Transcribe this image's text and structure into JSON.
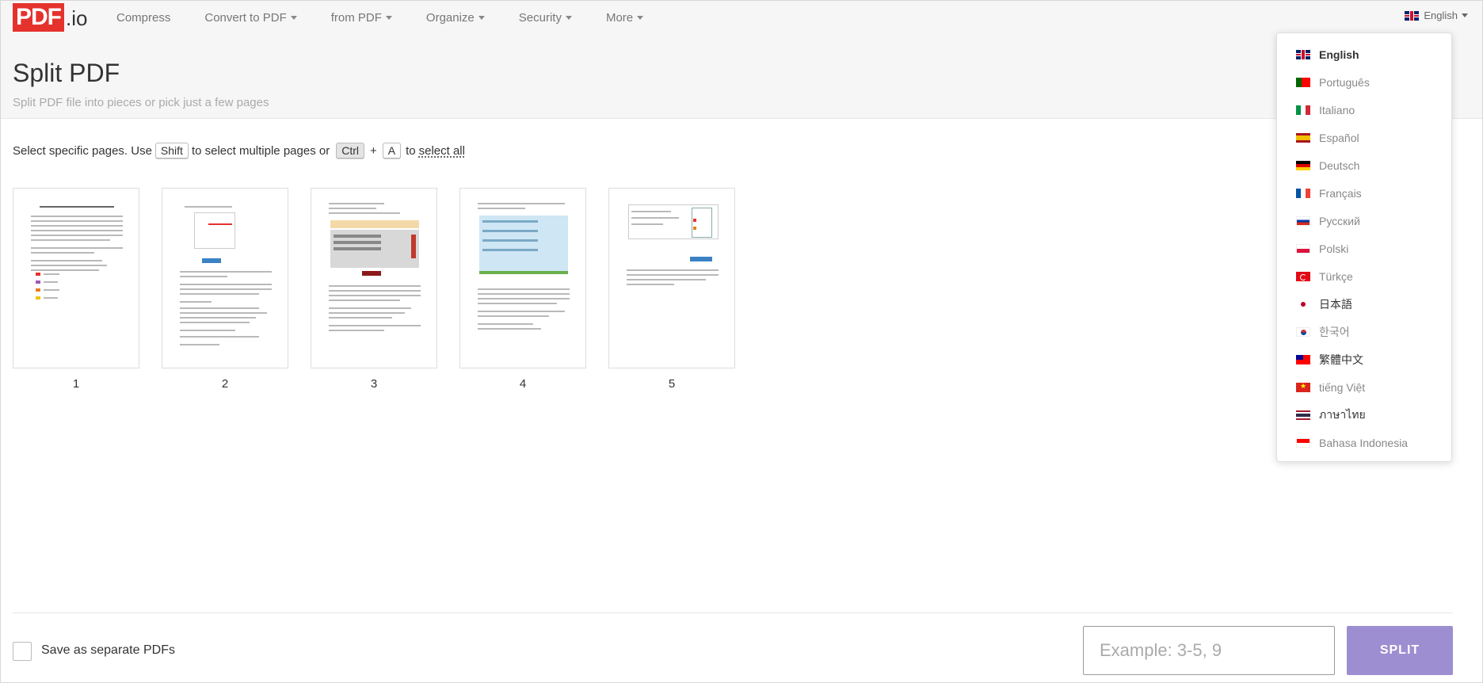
{
  "logo": {
    "brand": "PDF",
    "suffix": ".io"
  },
  "nav": {
    "items": [
      {
        "label": "Compress",
        "dropdown": false
      },
      {
        "label": "Convert to PDF",
        "dropdown": true
      },
      {
        "label": "from PDF",
        "dropdown": true
      },
      {
        "label": "Organize",
        "dropdown": true
      },
      {
        "label": "Security",
        "dropdown": true
      },
      {
        "label": "More",
        "dropdown": true
      }
    ],
    "language": "English"
  },
  "header": {
    "title": "Split PDF",
    "subtitle": "Split PDF file into pieces or pick just a few pages"
  },
  "instructions": {
    "prefix": "Select specific pages. Use",
    "key_shift": "Shift",
    "middle": "to select multiple pages or",
    "key_ctrl": "Ctrl",
    "plus": "+",
    "key_a": "A",
    "to": "to",
    "select_all": "select all"
  },
  "pages": [
    "1",
    "2",
    "3",
    "4",
    "5"
  ],
  "language_menu": [
    {
      "label": "English",
      "flag": "uk",
      "active": true
    },
    {
      "label": "Português",
      "flag": "pt",
      "active": false
    },
    {
      "label": "Italiano",
      "flag": "it",
      "active": false
    },
    {
      "label": "Español",
      "flag": "es",
      "active": false
    },
    {
      "label": "Deutsch",
      "flag": "de",
      "active": false
    },
    {
      "label": "Français",
      "flag": "fr",
      "active": false
    },
    {
      "label": "Русский",
      "flag": "ru",
      "active": false
    },
    {
      "label": "Polski",
      "flag": "pl",
      "active": false
    },
    {
      "label": "Türkçe",
      "flag": "tr",
      "active": false
    },
    {
      "label": "日本語",
      "flag": "jp",
      "active": false
    },
    {
      "label": "한국어",
      "flag": "kr",
      "active": false
    },
    {
      "label": "繁體中文",
      "flag": "tw",
      "active": false
    },
    {
      "label": "tiếng Việt",
      "flag": "vn",
      "active": false
    },
    {
      "label": "ภาษาไทย",
      "flag": "th",
      "active": false
    },
    {
      "label": "Bahasa Indonesia",
      "flag": "id",
      "active": false
    }
  ],
  "footer": {
    "separate_label": "Save as separate PDFs",
    "range_placeholder": "Example: 3-5, 9",
    "split_label": "SPLIT"
  },
  "colors": {
    "brand_red": "#e5322d",
    "split_button": "#9d8ed1",
    "header_bg": "#f6f6f6"
  }
}
